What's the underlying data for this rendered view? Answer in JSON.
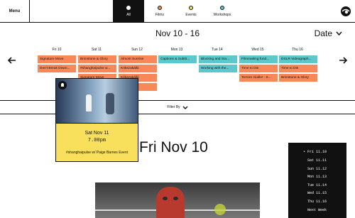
{
  "nav": {
    "menu_label": "Menu",
    "categories": [
      {
        "label": "All",
        "color": "#ffffff",
        "active": true
      },
      {
        "label": "Films",
        "color": "#f88858",
        "active": false
      },
      {
        "label": "Events",
        "color": "#f9e05c",
        "active": false
      },
      {
        "label": "Workshops",
        "color": "#5cc8cc",
        "active": false
      }
    ],
    "logo_icon": "eye-logo-icon"
  },
  "week": {
    "title": "Nov 10 - 16",
    "date_select_label": "Date",
    "prev_icon": "arrow-left-icon",
    "next_icon": "arrow-right-icon"
  },
  "days": [
    "Fri 10",
    "Sat 11",
    "Sun 12",
    "Mon 13",
    "Tue 14",
    "Wed 15",
    "Thu 16"
  ],
  "events": {
    "fri": [
      "Signature Move",
      "Don't Break Down..."
    ],
    "sat": [
      "Brimstone & Glory",
      "#shanghaipulse w...",
      "Signature Move"
    ],
    "sun": [
      "Almost Sunrise",
      "Kökszakállú",
      "Kékszakállú",
      "...tory -..."
    ],
    "mon": [
      "Captions & Subtit..."
    ],
    "tue": [
      "Blocking and Sta...",
      "Working with the..."
    ],
    "wed": [
      "Filmmaking fund...",
      "Time to Die",
      "Terrore Giallo! - S..."
    ],
    "thu": [
      "DSLR Videograph...",
      "Time to Die",
      "Brimstone & Glory"
    ]
  },
  "popup": {
    "date": "Sat Nov 11",
    "time": "7.00pm",
    "title": "#shanghaipulse w/ Paige Barnes Event",
    "badge_icon": "user-icon"
  },
  "filter": {
    "label": "Filter By",
    "icon": "chevron-down-icon"
  },
  "day_heading": "Fri Nov 10",
  "side_dates": [
    "Fri 11.10",
    "Sat 11.11",
    "Sun 11.12",
    "Mon 11.13",
    "Tue 11.14",
    "Wed 11.15",
    "Thu 11.16",
    "Next Week"
  ]
}
